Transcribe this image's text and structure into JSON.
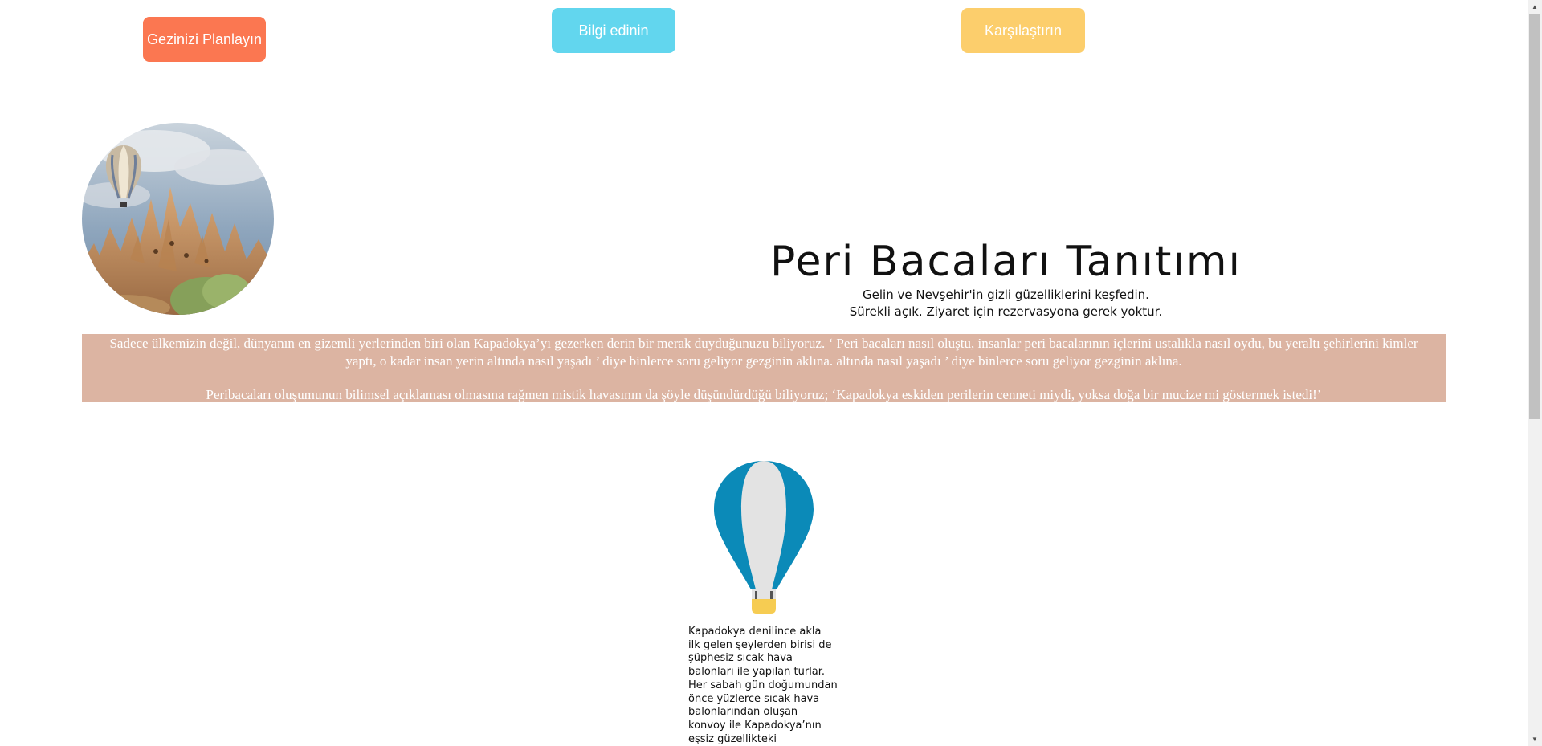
{
  "nav": {
    "plan_label": "Gezinizi Planlayın",
    "info_label": "Bilgi edinin",
    "compare_label": "Karşılaştırın"
  },
  "hero": {
    "title": "Peri Bacaları Tanıtımı",
    "subtitle_line1": "Gelin ve Nevşehir'in gizli güzelliklerini keşfedin.",
    "subtitle_line2": "Sürekli açık. Ziyaret için rezervasyona gerek yoktur."
  },
  "intro": {
    "paragraph1": "Sadece ülkemizin değil, dünyanın en gizemli yerlerinden biri olan Kapadokya’yı gezerken derin bir merak duyduğunuzu biliyoruz. ‘ Peri bacaları nasıl oluştu, insanlar peri bacalarının içlerini ustalıkla nasıl oydu, bu yeraltı şehirlerini kimler yaptı, o kadar insan yerin altında nasıl yaşadı ’ diye binlerce soru geliyor gezginin aklına. altında nasıl yaşadı ’ diye binlerce soru geliyor gezginin aklına.",
    "paragraph2": "Peribacaları oluşumunun bilimsel açıklaması olmasına rağmen mistik havasının da şöyle düşündürdüğü biliyoruz; ‘Kapadokya eskiden perilerin cenneti miydi, yoksa doğa bir mucize mi göstermek istedi!’"
  },
  "balloon_section": {
    "text": "Kapadokya denilince akla\nilk gelen şeylerden birisi de\nşüphesiz sıcak hava\nbalonları ile yapılan turlar.\nHer sabah gün doğumundan\nönce yüzlerce sıcak hava\nbalonlarından oluşan\nkonvoy ile Kapadokya’nın\neşsiz güzellikteki"
  },
  "icons": {
    "hero": "cappadocia-balloon-photo",
    "balloon": "hot-air-balloon-icon",
    "scroll_up": "scroll-up-arrow-icon",
    "scroll_down": "scroll-down-arrow-icon"
  },
  "colors": {
    "plan_button": "#fb7751",
    "info_button": "#62d6ee",
    "compare_button": "#fcce6c",
    "intro_background": "#dcb4a2",
    "balloon_blue": "#0b8ab8",
    "balloon_basket": "#f6cc52"
  }
}
